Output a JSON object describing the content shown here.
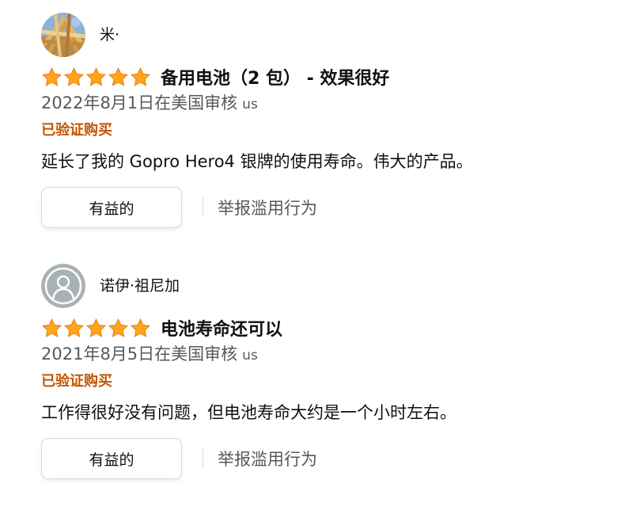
{
  "colors": {
    "star": "#ffa41c",
    "verified": "#c45500",
    "secondary_text": "#565959",
    "primary_text": "#0f1111",
    "button_border": "#d5d9d9"
  },
  "reviews": [
    {
      "profile_name": "米·",
      "avatar_icon": "woven-basket-photo-avatar",
      "rating": 5,
      "rating_max": 5,
      "title": "备用电池（2 包） - 效果很好",
      "date": "2022年8月1日在美国审核",
      "country": "us",
      "verified": "已验证购买",
      "body": "延长了我的 Gopro Hero4 银牌的使用寿命。伟大的产品。",
      "helpful_label": "有益的",
      "report_label": "举报滥用行为"
    },
    {
      "profile_name": "诺伊·祖尼加",
      "avatar_icon": "default-user-avatar",
      "rating": 5,
      "rating_max": 5,
      "title": "电池寿命还可以",
      "date": "2021年8月5日在美国审核",
      "country": "us",
      "verified": "已验证购买",
      "body": "工作得很好没有问题，但电池寿命大约是一个小时左右。",
      "helpful_label": "有益的",
      "report_label": "举报滥用行为"
    }
  ]
}
